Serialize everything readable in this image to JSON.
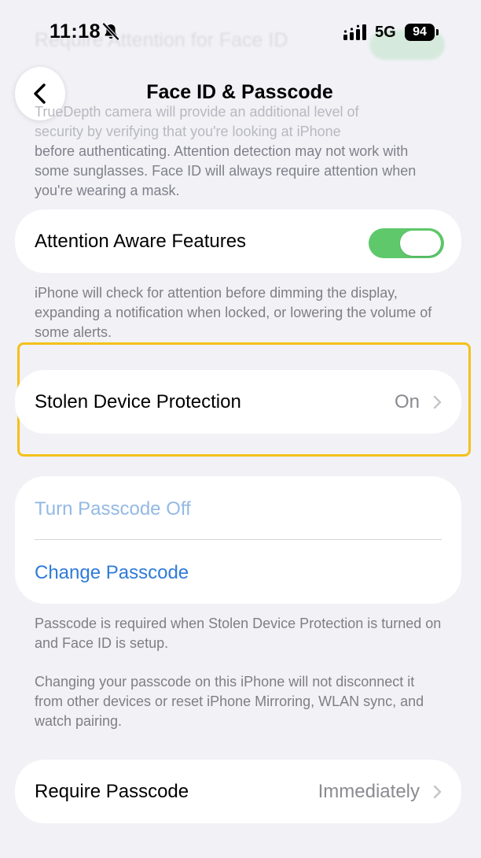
{
  "status_bar": {
    "time": "11:18",
    "network": "5G",
    "battery": "94"
  },
  "nav": {
    "title": "Face ID & Passcode"
  },
  "ghost": {
    "row_label": "Require Attention for Face ID",
    "footnote_line_1": "TrueDepth camera will provide an additional level of",
    "footnote_line_2": "security by verifying that you're looking at iPhone",
    "footnote_rest": "before authenticating. Attention detection may not work with some sunglasses. Face ID will always require attention when you're wearing a mask."
  },
  "attention_aware": {
    "label": "Attention Aware Features",
    "enabled": true,
    "footnote": "iPhone will check for attention before dimming the display, expanding a notification when locked, or lowering the volume of some alerts."
  },
  "stolen_device": {
    "label": "Stolen Device Protection",
    "value": "On"
  },
  "passcode": {
    "turn_off_label": "Turn Passcode Off",
    "change_label": "Change Passcode",
    "footnote_1": "Passcode is required when Stolen Device Protection is turned on and Face ID is setup.",
    "footnote_2": "Changing your passcode on this iPhone will not disconnect it from other devices or reset iPhone Mirroring, WLAN sync, and watch pairing."
  },
  "require_passcode": {
    "label": "Require Passcode",
    "value": "Immediately"
  },
  "colors": {
    "background": "#f1f1f6",
    "toggle_on": "#5ec86b",
    "link": "#2f7bd8",
    "link_disabled": "#93b9e6",
    "highlight": "#f3c11a"
  }
}
